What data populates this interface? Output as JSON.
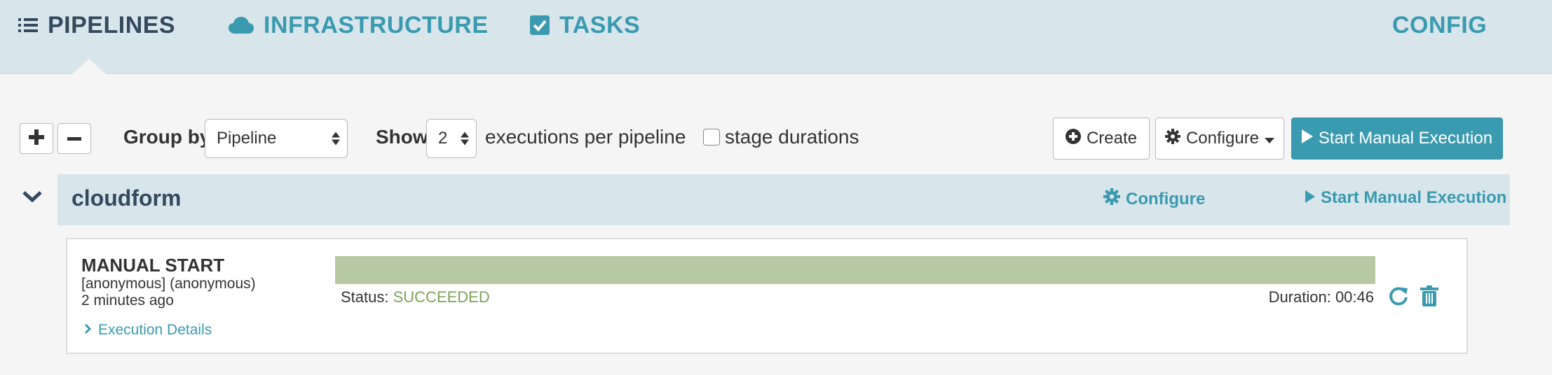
{
  "nav": {
    "pipelines": "PIPELINES",
    "infrastructure": "INFRASTRUCTURE",
    "tasks": "TASKS",
    "config": "CONFIG"
  },
  "controls": {
    "group_by_label": "Group by",
    "group_by_value": "Pipeline",
    "show_label": "Show",
    "show_value": "2",
    "per_pipeline_text": "executions per pipeline",
    "stage_durations_label": "stage durations",
    "create_label": "Create",
    "configure_label": "Configure",
    "start_manual_label": "Start Manual Execution"
  },
  "group": {
    "name": "cloudform",
    "configure_label": "Configure",
    "start_manual_label": "Start Manual Execution"
  },
  "execution": {
    "trigger": "MANUAL START",
    "user": "[anonymous] (anonymous)",
    "time": "2 minutes ago",
    "details_label": "Execution Details",
    "status_label": "Status:",
    "status_value": "SUCCEEDED",
    "duration_text": "Duration: 00:46"
  },
  "colors": {
    "accent": "#3a9ab0",
    "nav_background": "#d8e6ec",
    "succeeded": "#7ca35a",
    "stage_bar": "#b7c9a3"
  },
  "icons": [
    "list-icon",
    "cloud-icon",
    "check-square-icon",
    "plus-icon",
    "minus-icon",
    "plus-circle-icon",
    "gear-icon",
    "caret-down-icon",
    "play-icon",
    "chevron-down-icon",
    "chevron-right-icon",
    "refresh-icon",
    "trash-icon"
  ]
}
